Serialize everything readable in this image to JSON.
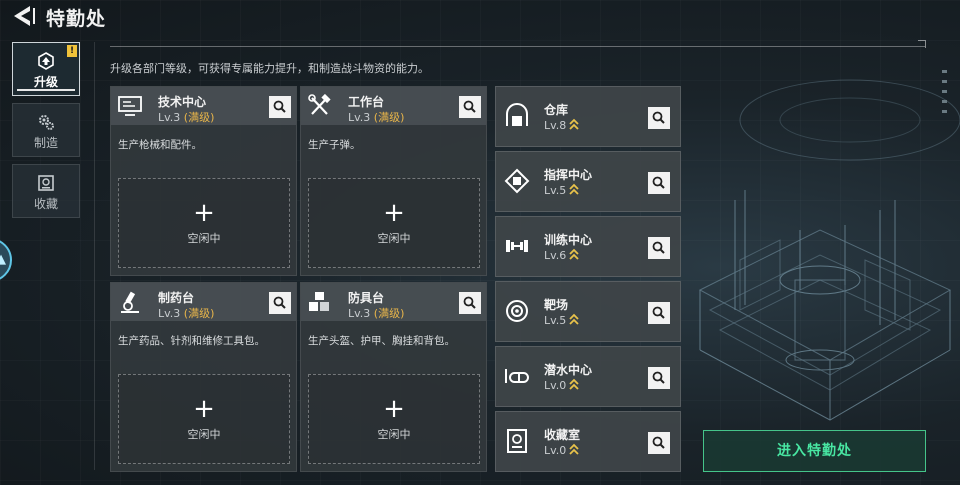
{
  "header": {
    "title": "特勤处"
  },
  "tabs": [
    {
      "label": "升级",
      "icon": "upgrade-icon",
      "active": true,
      "badge": "!"
    },
    {
      "label": "制造",
      "icon": "gears-icon",
      "active": false
    },
    {
      "label": "收藏",
      "icon": "collection-icon",
      "active": false
    }
  ],
  "description": "升级各部门等级，可获得专属能力提升，和制造战斗物资的能力。",
  "cards": [
    {
      "name": "技术中心",
      "level": "Lv.3",
      "status": "(满级)",
      "desc": "生产枪械和配件。",
      "slot": "空闲中",
      "icon": "monitor-icon"
    },
    {
      "name": "工作台",
      "level": "Lv.3",
      "status": "(满级)",
      "desc": "生产子弹。",
      "slot": "空闲中",
      "icon": "tools-icon"
    },
    {
      "name": "制药台",
      "level": "Lv.3",
      "status": "(满级)",
      "desc": "生产药品、针剂和维修工具包。",
      "slot": "空闲中",
      "icon": "microscope-icon"
    },
    {
      "name": "防具台",
      "level": "Lv.3",
      "status": "(满级)",
      "desc": "生产头盔、护甲、胸挂和背包。",
      "slot": "空闲中",
      "icon": "boxes-icon"
    }
  ],
  "facilities": [
    {
      "name": "仓库",
      "level": "Lv.8",
      "icon": "warehouse-icon"
    },
    {
      "name": "指挥中心",
      "level": "Lv.5",
      "icon": "chip-icon"
    },
    {
      "name": "训练中心",
      "level": "Lv.6",
      "icon": "dumbbell-icon"
    },
    {
      "name": "靶场",
      "level": "Lv.5",
      "icon": "target-icon"
    },
    {
      "name": "潜水中心",
      "level": "Lv.0",
      "icon": "diving-icon"
    },
    {
      "name": "收藏室",
      "level": "Lv.0",
      "icon": "vault-icon"
    }
  ],
  "enter_button": "进入特勤处",
  "colors": {
    "accent_green": "#48e6a2",
    "maxed_gold": "#e8b54a",
    "upgrade_chevron": "#e8c24a"
  }
}
